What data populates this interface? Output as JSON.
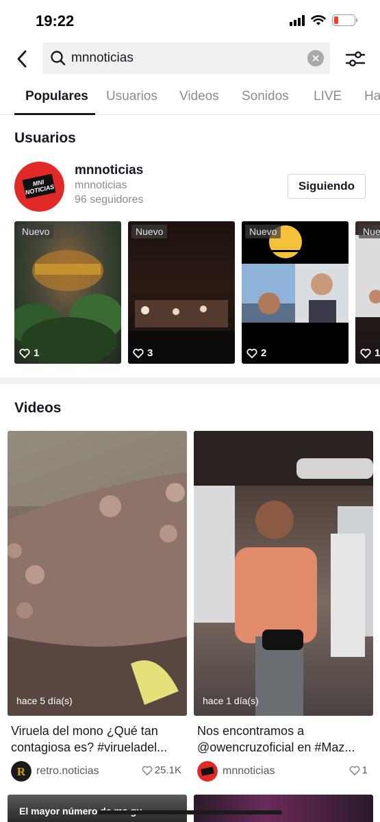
{
  "status": {
    "time": "19:22",
    "battery_level": 0.2
  },
  "search": {
    "query": "mnnoticias"
  },
  "tabs": [
    {
      "label": "Populares",
      "active": true
    },
    {
      "label": "Usuarios"
    },
    {
      "label": "Videos"
    },
    {
      "label": "Sonidos"
    },
    {
      "label": "LIVE"
    },
    {
      "label": "Ha"
    }
  ],
  "users_section": {
    "title": "Usuarios",
    "user": {
      "name": "mnnoticias",
      "handle": "mnnoticias",
      "followers": "96 seguidores",
      "follow_button": "Siguiendo",
      "avatar_text_1": "MNI",
      "avatar_text_2": "NOTICIAS"
    },
    "thumbnails": [
      {
        "badge": "Nuevo",
        "likes": "1"
      },
      {
        "badge": "Nuevo",
        "likes": "3"
      },
      {
        "badge": "Nuevo",
        "likes": "2"
      },
      {
        "badge": "Nue",
        "likes": "1"
      }
    ]
  },
  "videos_section": {
    "title": "Videos",
    "videos": [
      {
        "time_ago": "hace 5 día(s)",
        "title": "Viruela del mono ¿Qué tan contagiosa es? #virueladel...",
        "author": "retro.noticias",
        "likes": "25.1K"
      },
      {
        "time_ago": "hace 1 día(s)",
        "title": "Nos encontramos a @owencruzoficial en #Maz...",
        "author": "mnnoticias",
        "likes": "1"
      }
    ],
    "ticker": "El mayor número de ma gu..."
  }
}
